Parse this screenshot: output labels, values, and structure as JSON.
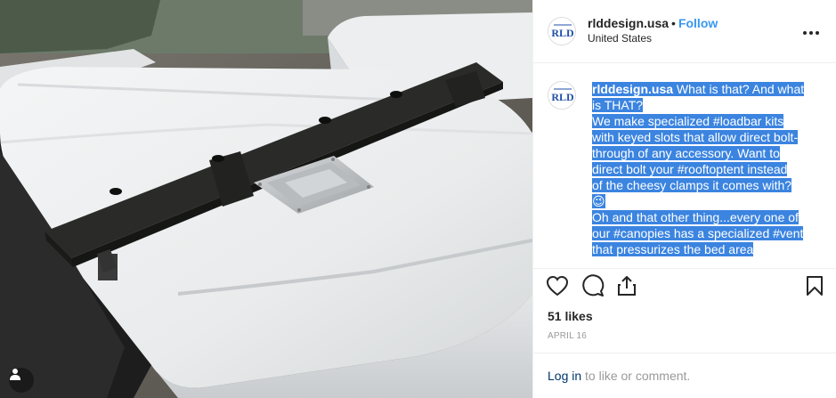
{
  "post": {
    "username": "rlddesign.usa",
    "separator": "•",
    "follow_label": "Follow",
    "location": "United States",
    "more_label": "•••",
    "avatar_text": "RLD"
  },
  "caption": {
    "username": "rlddesign.usa",
    "lines": [
      "What is that? And what",
      "is THAT?",
      "We make specialized #loadbar kits",
      "with keyed slots that allow direct bolt-",
      "through of any accessory. Want to",
      "direct bolt your #rooftoptent instead",
      "of the cheesy clamps it comes with?",
      "😉",
      "Oh and that other thing...every one of",
      "our #canopies has a specialized #vent",
      "that pressurizes the bed area "
    ]
  },
  "stats": {
    "likes": "51 likes",
    "date": "APRIL 16"
  },
  "login": {
    "link": "Log in",
    "rest": " to like or comment."
  },
  "icons": [
    "heart-icon",
    "comment-icon",
    "share-icon",
    "bookmark-icon",
    "user-tag-icon"
  ]
}
